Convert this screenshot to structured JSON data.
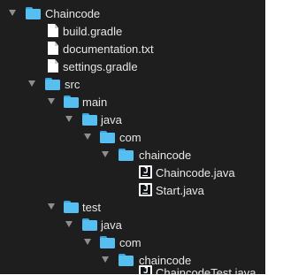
{
  "tree": {
    "root": {
      "label": "Chaincode",
      "icon": "folder-icon"
    },
    "root_files": [
      {
        "label": "build.gradle",
        "icon": "file-icon"
      },
      {
        "label": "documentation.txt",
        "icon": "file-icon"
      },
      {
        "label": "settings.gradle",
        "icon": "file-icon"
      }
    ],
    "src": {
      "label": "src",
      "icon": "folder-icon"
    },
    "src_main": {
      "label": "main",
      "icon": "folder-icon"
    },
    "src_main_java": {
      "label": "java",
      "icon": "folder-icon"
    },
    "src_main_com": {
      "label": "com",
      "icon": "folder-icon"
    },
    "src_main_chaincode": {
      "label": "chaincode",
      "icon": "folder-icon"
    },
    "src_main_files": [
      {
        "label": "Chaincode.java",
        "icon": "java-file-icon"
      },
      {
        "label": "Start.java",
        "icon": "java-file-icon"
      }
    ],
    "test": {
      "label": "test",
      "icon": "folder-icon"
    },
    "test_java": {
      "label": "java",
      "icon": "folder-icon"
    },
    "test_com": {
      "label": "com",
      "icon": "folder-icon"
    },
    "test_chaincode": {
      "label": "chaincode",
      "icon": "folder-icon"
    },
    "test_files": [
      {
        "label": "ChaincodeTest.java",
        "icon": "java-file-icon"
      }
    ]
  },
  "colors": {
    "background": "#1e1e1e",
    "folder_body": "#56bff1",
    "folder_tab": "#38a4df",
    "text": "#e6e6e6",
    "disclosure_arrow": "#8e8e8e"
  }
}
